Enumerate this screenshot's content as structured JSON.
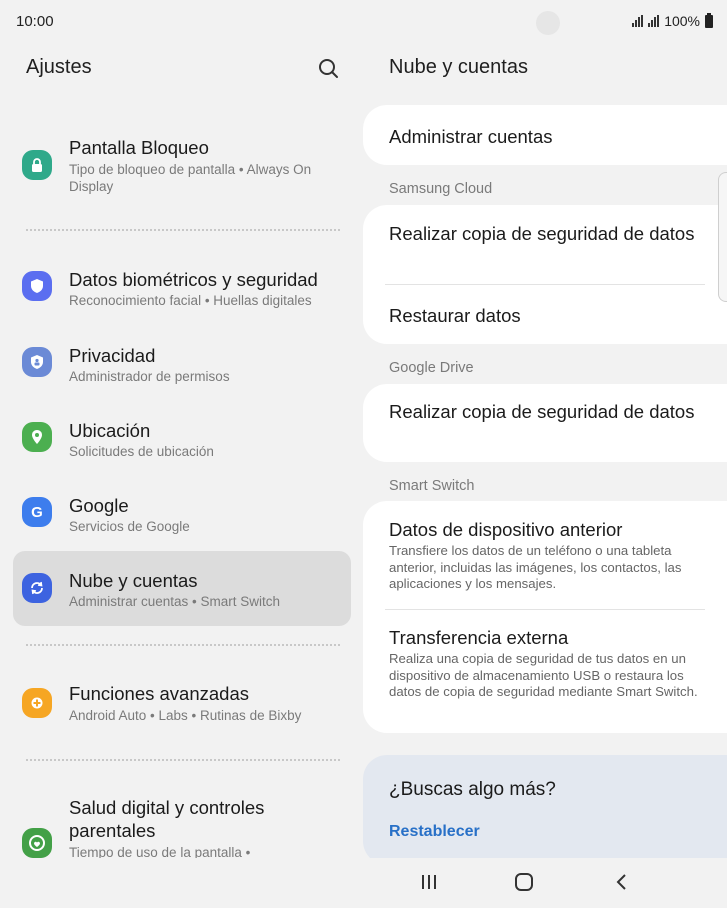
{
  "status": {
    "time": "10:00",
    "battery": "100%"
  },
  "left": {
    "title": "Ajustes",
    "items": [
      {
        "title": "Pantalla Bloqueo",
        "subtitle": "Tipo de bloqueo de pantalla  •  Always On Display",
        "icon": "lock-icon",
        "color": "#2fa98a"
      },
      {
        "title": "Datos biométricos y seguridad",
        "subtitle": "Reconocimiento facial  •  Huellas digitales",
        "icon": "shield-icon",
        "color": "#5b6ef0"
      },
      {
        "title": "Privacidad",
        "subtitle": "Administrador de permisos",
        "icon": "privacy-icon",
        "color": "#6b8ad6"
      },
      {
        "title": "Ubicación",
        "subtitle": "Solicitudes de ubicación",
        "icon": "location-pin-icon",
        "color": "#4caf50"
      },
      {
        "title": "Google",
        "subtitle": "Servicios de Google",
        "icon": "google-icon",
        "color": "#3d7ded"
      },
      {
        "title": "Nube y cuentas",
        "subtitle": "Administrar cuentas  •  Smart Switch",
        "icon": "sync-icon",
        "color": "#3d63e0"
      },
      {
        "title": "Funciones avanzadas",
        "subtitle": "Android Auto  •  Labs  •  Rutinas de Bixby",
        "icon": "gear-plus-icon",
        "color": "#f6a623"
      },
      {
        "title": "Salud digital y controles parentales",
        "subtitle": "Tiempo de uso de la pantalla  •",
        "icon": "digital-wellbeing-icon",
        "color": "#43a047"
      }
    ]
  },
  "right": {
    "title": "Nube y cuentas",
    "manage_accounts": "Administrar cuentas",
    "samsung_cloud_label": "Samsung Cloud",
    "samsung_backup": "Realizar copia de seguridad de datos",
    "samsung_restore": "Restaurar datos",
    "google_drive_label": "Google Drive",
    "google_backup": "Realizar copia de seguridad de datos",
    "smart_switch_label": "Smart Switch",
    "old_device_title": "Datos de dispositivo anterior",
    "old_device_desc": "Transfiere los datos de un teléfono o una tableta anterior, incluidas las imágenes, los contactos, las aplicaciones y los mensajes.",
    "external_title": "Transferencia externa",
    "external_desc": "Realiza una copia de seguridad de tus datos en un dispositivo de almacenamiento USB o restaura los datos de copia de seguridad mediante Smart Switch.",
    "more_title": "¿Buscas algo más?",
    "more_link": "Restablecer"
  },
  "nav": {
    "recents": "recents-icon",
    "home": "home-icon",
    "back": "back-icon"
  }
}
